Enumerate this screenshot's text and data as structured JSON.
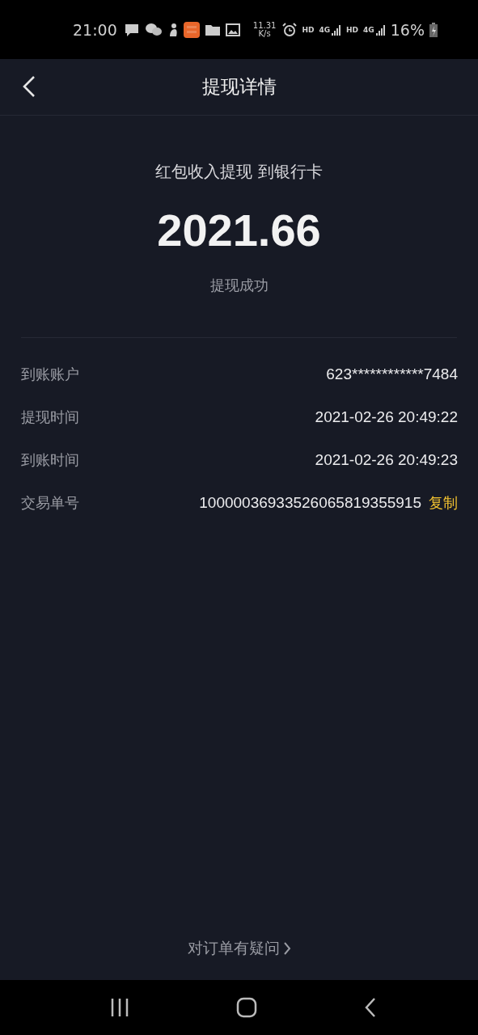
{
  "status_bar": {
    "time": "21:00",
    "speed": "11.31",
    "speed_unit": "K/s",
    "signals": [
      {
        "hd": "HD",
        "net": "4G"
      },
      {
        "hd": "HD",
        "net": "4G"
      }
    ],
    "battery": "16%"
  },
  "header": {
    "title": "提现详情"
  },
  "summary": {
    "subtitle": "红包收入提现 到银行卡",
    "amount": "2021.66",
    "status": "提现成功"
  },
  "details": [
    {
      "label": "到账账户",
      "value": "623************7484"
    },
    {
      "label": "提现时间",
      "value": "2021-02-26 20:49:22"
    },
    {
      "label": "到账时间",
      "value": "2021-02-26 20:49:23"
    },
    {
      "label": "交易单号",
      "value": "10000036933526065819355915",
      "action": "复制"
    }
  ],
  "footer": {
    "link": "对订单有疑问"
  }
}
